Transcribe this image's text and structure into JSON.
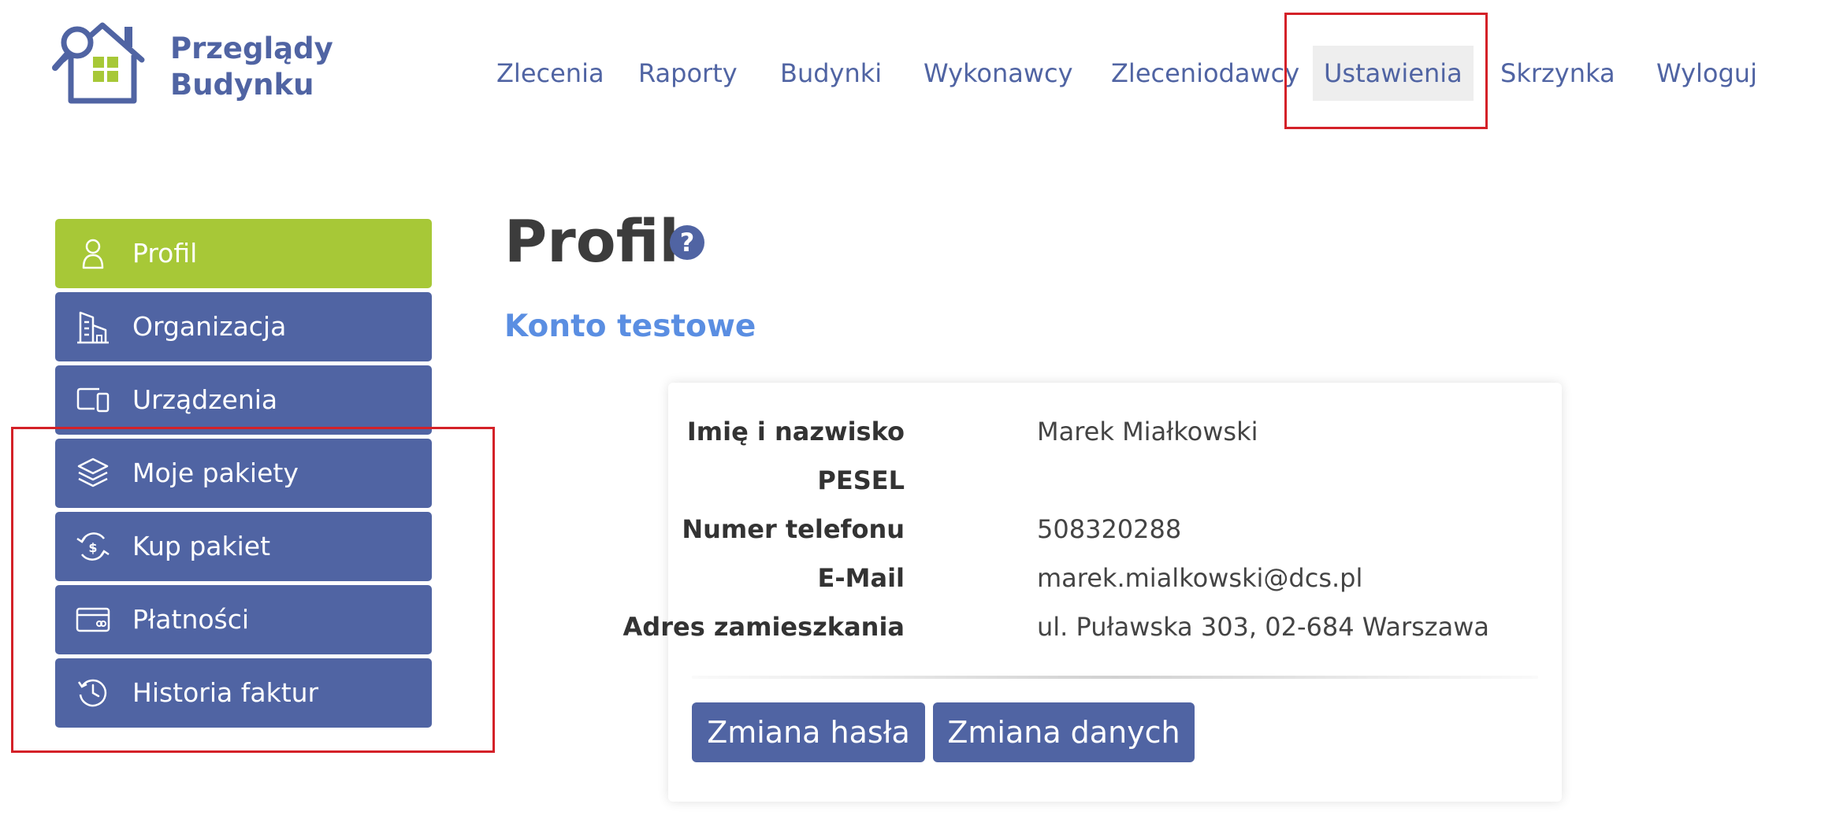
{
  "brand": {
    "line1": "Przeglądy",
    "line2": "Budynku"
  },
  "nav": {
    "items": [
      "Zlecenia",
      "Raporty",
      "Budynki",
      "Wykonawcy",
      "Zleceniodawcy",
      "Ustawienia",
      "Skrzynka",
      "Wyloguj"
    ],
    "active": "Ustawienia"
  },
  "sidebar": {
    "items": [
      {
        "label": "Profil",
        "icon": "user-icon",
        "active": true
      },
      {
        "label": "Organizacja",
        "icon": "building-icon"
      },
      {
        "label": "Urządzenia",
        "icon": "devices-icon"
      },
      {
        "label": "Moje pakiety",
        "icon": "layers-icon"
      },
      {
        "label": "Kup pakiet",
        "icon": "exchange-dollar-icon"
      },
      {
        "label": "Płatności",
        "icon": "credit-card-icon"
      },
      {
        "label": "Historia faktur",
        "icon": "history-icon"
      }
    ]
  },
  "main": {
    "title": "Profil",
    "help": "?",
    "account": "Konto testowe",
    "fields": [
      {
        "label": "Imię i nazwisko",
        "value": "Marek Miałkowski"
      },
      {
        "label": "PESEL",
        "value": ""
      },
      {
        "label": "Numer telefonu",
        "value": "508320288"
      },
      {
        "label": "E-Mail",
        "value": "marek.mialkowski@dcs.pl"
      },
      {
        "label": "Adres zamieszkania",
        "value": "ul. Puławska 303, 02-684 Warszawa"
      }
    ],
    "buttons": {
      "change_password": "Zmiana hasła",
      "change_data": "Zmiana danych"
    }
  },
  "colors": {
    "primary": "#5064a3",
    "active": "#a7c837",
    "accent_text": "#5a8ee2",
    "highlight": "#d42128"
  }
}
